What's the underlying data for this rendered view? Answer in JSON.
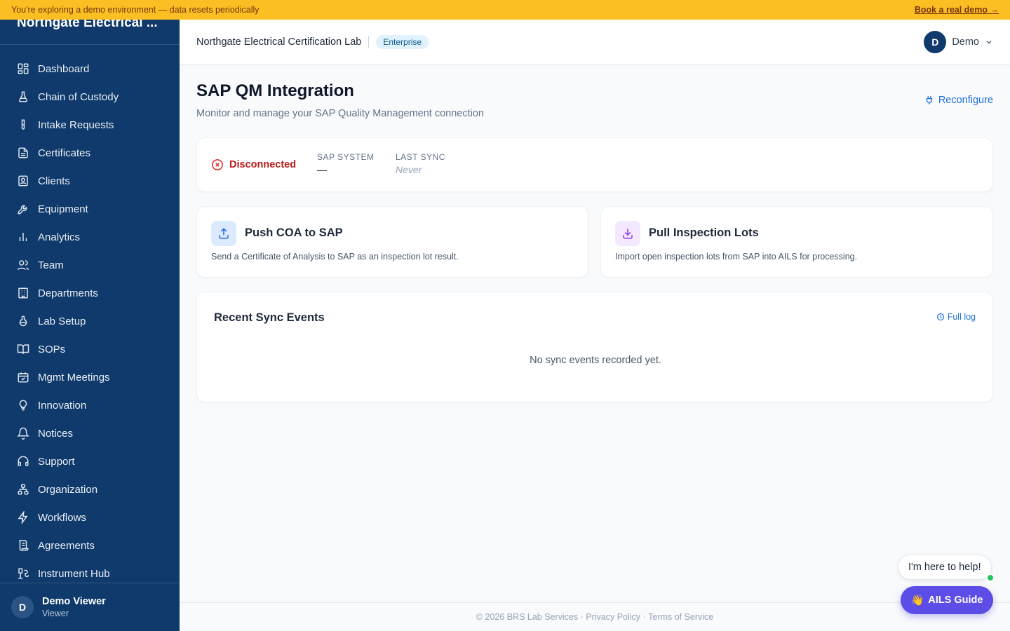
{
  "banner": {
    "text": "You're exploring a demo environment — data resets periodically",
    "link": "Book a real demo →"
  },
  "sidebar": {
    "org": "Northgate Electrical ...",
    "items": [
      {
        "label": "Dashboard",
        "icon": "dashboard-icon"
      },
      {
        "label": "Chain of Custody",
        "icon": "flask-icon"
      },
      {
        "label": "Intake Requests",
        "icon": "test-tube-icon"
      },
      {
        "label": "Certificates",
        "icon": "document-icon"
      },
      {
        "label": "Clients",
        "icon": "contact-card-icon"
      },
      {
        "label": "Equipment",
        "icon": "wrench-icon"
      },
      {
        "label": "Analytics",
        "icon": "bar-chart-icon"
      },
      {
        "label": "Team",
        "icon": "users-icon"
      },
      {
        "label": "Departments",
        "icon": "building-icon"
      },
      {
        "label": "Lab Setup",
        "icon": "beaker-icon"
      },
      {
        "label": "SOPs",
        "icon": "book-icon"
      },
      {
        "label": "Mgmt Meetings",
        "icon": "calendar-check-icon"
      },
      {
        "label": "Innovation",
        "icon": "lightbulb-icon"
      },
      {
        "label": "Notices",
        "icon": "bell-icon"
      },
      {
        "label": "Support",
        "icon": "headset-icon"
      },
      {
        "label": "Organization",
        "icon": "org-chart-icon"
      },
      {
        "label": "Workflows",
        "icon": "lightning-icon"
      },
      {
        "label": "Agreements",
        "icon": "scroll-icon"
      },
      {
        "label": "Instrument Hub",
        "icon": "instrument-icon"
      }
    ],
    "user": {
      "initial": "D",
      "name": "Demo Viewer",
      "role": "Viewer"
    }
  },
  "topbar": {
    "lab": "Northgate Electrical Certification Lab",
    "tier": "Enterprise",
    "user_initial": "D",
    "user_name": "Demo"
  },
  "page": {
    "title": "SAP QM Integration",
    "subtitle": "Monitor and manage your SAP Quality Management connection",
    "reconfigure": "Reconfigure"
  },
  "status": {
    "state": "Disconnected",
    "system_label": "SAP SYSTEM",
    "system_value": "—",
    "sync_label": "LAST SYNC",
    "sync_value": "Never"
  },
  "actions": [
    {
      "title": "Push COA to SAP",
      "desc": "Send a Certificate of Analysis to SAP as an inspection lot result.",
      "icon": "upload-icon"
    },
    {
      "title": "Pull Inspection Lots",
      "desc": "Import open inspection lots from SAP into AILS for processing.",
      "icon": "download-icon"
    }
  ],
  "events": {
    "title": "Recent Sync Events",
    "full_log": "Full log",
    "empty": "No sync events recorded yet."
  },
  "footer": {
    "copyright": "© 2026 BRS Lab Services",
    "sep": " · ",
    "privacy": "Privacy Policy",
    "terms": "Terms of Service"
  },
  "assistant": {
    "bubble": "I'm here to help!",
    "wave": "👋",
    "button": "AILS Guide"
  },
  "colors": {
    "sidebar": "#0f3a6b",
    "banner": "#fbbf24",
    "accent": "#1d6fd8",
    "danger": "#b91c1c",
    "guide": "#5b4de6"
  }
}
